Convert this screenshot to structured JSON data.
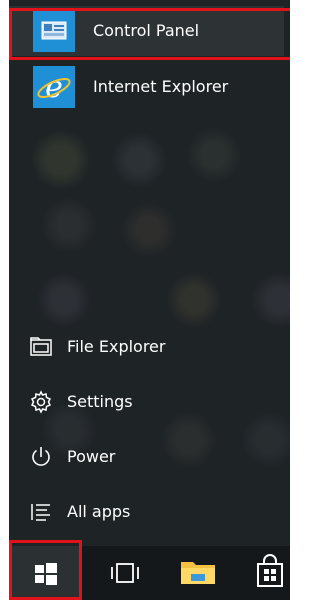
{
  "start_menu": {
    "apps": [
      {
        "label": "Control Panel",
        "icon": "control-panel-icon"
      },
      {
        "label": "Internet Explorer",
        "icon": "internet-explorer-icon"
      }
    ],
    "system_items": [
      {
        "label": "File Explorer",
        "icon": "file-explorer-icon"
      },
      {
        "label": "Settings",
        "icon": "gear-icon"
      },
      {
        "label": "Power",
        "icon": "power-icon"
      },
      {
        "label": "All apps",
        "icon": "all-apps-list-icon"
      }
    ]
  },
  "taskbar": {
    "buttons": [
      {
        "icon": "windows-start-icon"
      },
      {
        "icon": "task-view-icon"
      },
      {
        "icon": "file-explorer-folder-icon"
      },
      {
        "icon": "store-bag-icon"
      }
    ]
  },
  "colors": {
    "accent": "#1f8fd6",
    "highlight_box": "#e1121a",
    "menu_background": "#1e2326",
    "taskbar_background": "#15181a"
  }
}
